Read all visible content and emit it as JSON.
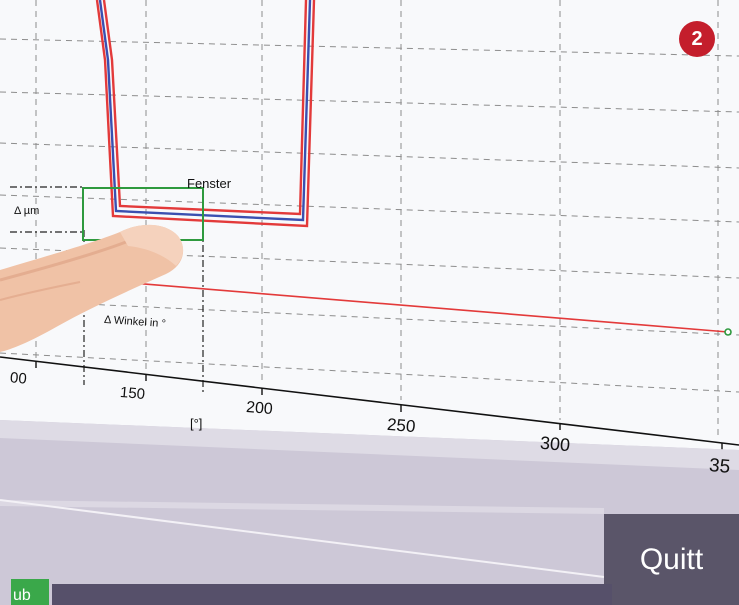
{
  "badge": {
    "number": "2",
    "color": "#c41e2c"
  },
  "chart": {
    "window_label": "Fenster",
    "delta_um_label": "Δ µm",
    "delta_angle_label": "Δ Winkel in °",
    "x_unit_label": "[°]",
    "x_ticks": [
      "00",
      "150",
      "200",
      "250",
      "300",
      "35"
    ]
  },
  "toolbar": {
    "quitt_label": "Quitt",
    "green_tab_label": "ub"
  },
  "colors": {
    "envelope_red": "#e33a3a",
    "curve_blue": "#3a4fb0",
    "window_green": "#2e9a3e",
    "panel": "#cdc8d7",
    "dark_button": "#5a5569"
  }
}
